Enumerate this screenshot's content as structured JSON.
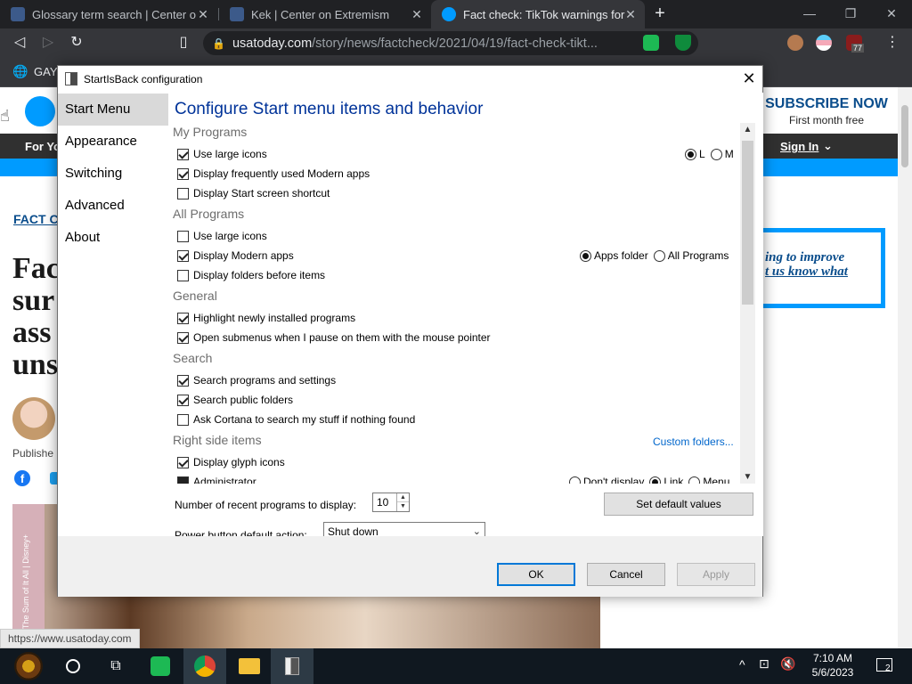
{
  "browser": {
    "tabs": [
      {
        "title": "Glossary term search | Center o",
        "active": false
      },
      {
        "title": "Kek | Center on Extremism",
        "active": false
      },
      {
        "title": "Fact check: TikTok warnings for",
        "active": true
      }
    ],
    "url_host": "usatoday.com",
    "url_path": "/story/news/factcheck/2021/04/19/fact-check-tikt...",
    "bookmark_label": "GAY",
    "ext_badge": "77"
  },
  "website": {
    "subscribe_title": "SUBSCRIBE NOW",
    "subscribe_sub": "First month free",
    "nav_left": "For Yo",
    "nav_signin": "Sign In",
    "fact_link": "FACT C",
    "headline_lines": [
      "Fac",
      "sur",
      "ass",
      "uns"
    ],
    "published": "Publishe",
    "promo_line1": "ing to improve",
    "promo_line2": "t us know what",
    "hero_caption": "n: The Sum of It All | Disney+",
    "status_url": "https://www.usatoday.com"
  },
  "dialog": {
    "title": "StartIsBack configuration",
    "close": "✕",
    "sidebar": [
      "Start Menu",
      "Appearance",
      "Switching",
      "Advanced",
      "About"
    ],
    "selected": "Start Menu",
    "heading": "Configure Start menu items and behavior",
    "sections": {
      "my_programs": "My Programs",
      "all_programs": "All Programs",
      "general": "General",
      "search": "Search",
      "right_side": "Right side items"
    },
    "options": {
      "mp_large_icons": {
        "label": "Use large icons",
        "checked": true
      },
      "mp_freq_modern": {
        "label": "Display frequently used Modern apps",
        "checked": true
      },
      "mp_start_screen": {
        "label": "Display Start screen shortcut",
        "checked": false
      },
      "ap_large_icons": {
        "label": "Use large icons",
        "checked": false
      },
      "ap_modern_apps": {
        "label": "Display Modern apps",
        "checked": true
      },
      "ap_folders_before": {
        "label": "Display folders before items",
        "checked": false
      },
      "gen_highlight": {
        "label": "Highlight newly installed programs",
        "checked": true
      },
      "gen_submenus": {
        "label": "Open submenus when I pause on them with the mouse pointer",
        "checked": true
      },
      "s_programs": {
        "label": "Search programs and settings",
        "checked": true
      },
      "s_public": {
        "label": "Search public folders",
        "checked": true
      },
      "s_cortana": {
        "label": "Ask Cortana to search my stuff if nothing found",
        "checked": false
      },
      "rs_glyph": {
        "label": "Display glyph icons",
        "checked": true
      },
      "rs_admin": {
        "label": "Administrator",
        "checked": true
      }
    },
    "radios": {
      "icon_size": {
        "L": "L",
        "M": "M",
        "selected": "L"
      },
      "modern_location": {
        "apps_folder": "Apps folder",
        "all_programs": "All Programs",
        "selected": "Apps folder"
      },
      "admin_display": {
        "dont": "Don't display",
        "link": "Link",
        "menu": "Menu",
        "selected": "Link"
      }
    },
    "custom_folders": "Custom folders...",
    "recent_label": "Number of recent programs to display:",
    "recent_value": "10",
    "set_default": "Set default values",
    "power_label": "Power button default action:",
    "power_value": "Shut down",
    "ok": "OK",
    "cancel": "Cancel",
    "apply": "Apply"
  },
  "taskbar": {
    "time": "7:10 AM",
    "date": "5/6/2023",
    "notifications": "2"
  }
}
